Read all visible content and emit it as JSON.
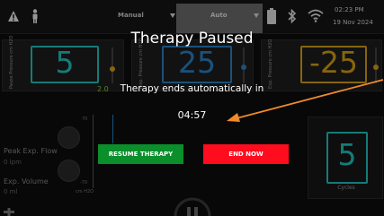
{
  "status_bar": {
    "mode_options": [
      "Manual",
      "Auto"
    ],
    "time": "02:23 PM",
    "date": "19 Nov 2024"
  },
  "tiles": [
    {
      "label": "Pause Pressure\ncm H2O",
      "value": "5",
      "color": "#22c7c2"
    },
    {
      "label": "Insp. Pressure\ncm H2O",
      "value": "25",
      "color": "#2a83c8"
    },
    {
      "label": "Exp. Pressure\ncm H2O",
      "value": "-25",
      "color": "#d8a418"
    }
  ],
  "slider_value_label": "2.0",
  "left_panel": {
    "peak_flow_label": "Peak Exp. Flow",
    "peak_flow_unit": "0 lpm",
    "exp_volume_label": "Exp. Volume",
    "exp_volume_unit": "0 ml",
    "axis_unit": "cm H2O",
    "axis_ticks": [
      "70",
      "-70"
    ]
  },
  "cycles": {
    "value": "5",
    "label": "Cycles"
  },
  "modal": {
    "title": "Therapy Paused",
    "message": "Therapy ends automatically in",
    "countdown": "04:57",
    "resume_label": "RESUME THERAPY",
    "end_label": "END NOW"
  },
  "colors": {
    "resume": "#0a8f2b",
    "end_now": "#ff0c1e",
    "annotation_arrow": "#f08a2a",
    "teal": "#22c7c2",
    "blue": "#2a83c8",
    "amber": "#d8a418"
  }
}
